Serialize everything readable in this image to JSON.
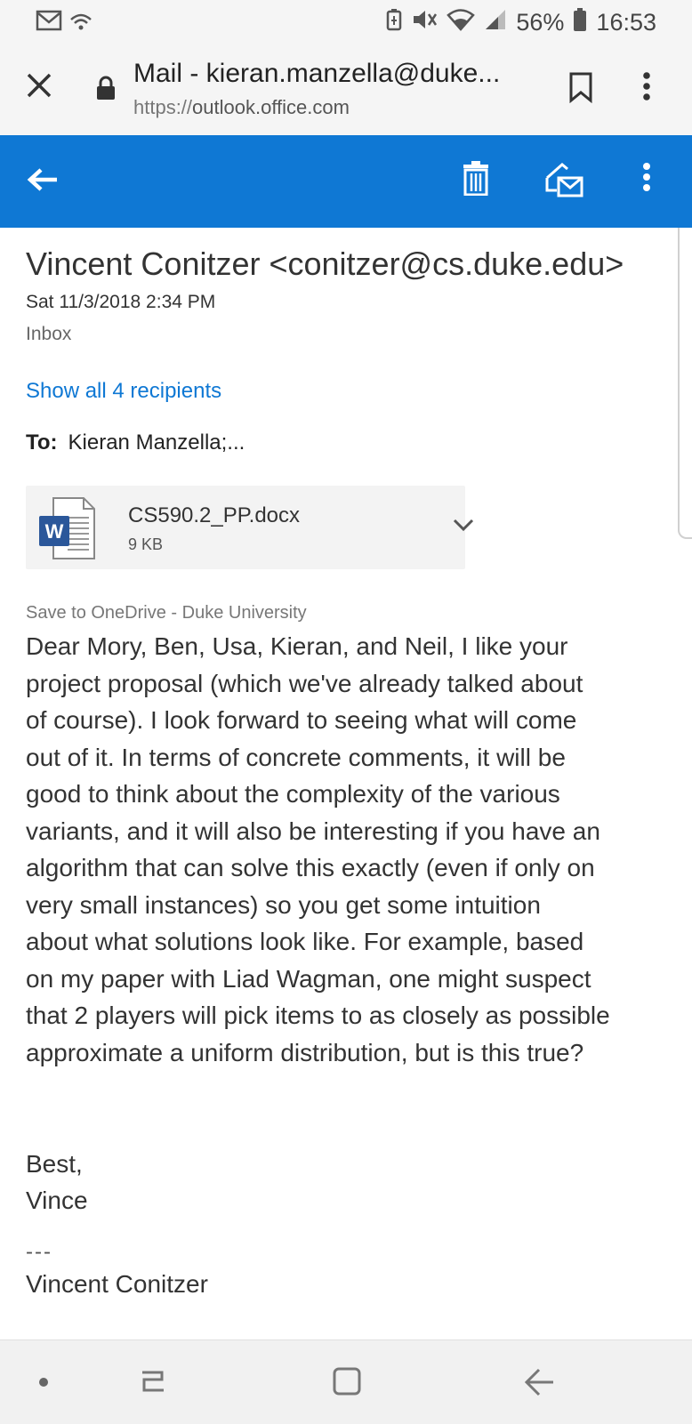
{
  "status_bar": {
    "battery": "56%",
    "time": "16:53"
  },
  "browser": {
    "title": "Mail - kieran.manzella@duke...",
    "url_prefix": "https://",
    "url_host": "outlook.office.com"
  },
  "email": {
    "sender": "Vincent Conitzer <conitzer@cs.duke.edu>",
    "date": "Sat 11/3/2018 2:34 PM",
    "folder": "Inbox",
    "recipients_link": "Show all 4 recipients",
    "to_label": "To:",
    "to_value": "Kieran Manzella;...",
    "attachment": {
      "name": "CS590.2_PP.docx",
      "size": "9 KB"
    },
    "save_link": "Save to OneDrive - Duke University",
    "body_lines": [
      "Dear Mory, Ben, Usa, Kieran, and Neil, I like your",
      "project proposal (which we've already talked about",
      "of course).  I look forward to seeing what will come",
      "out of it.  In terms of concrete comments, it will be",
      "good to think about the complexity of the various",
      "variants, and it will also be interesting if you have an",
      "algorithm that can solve this exactly (even if only on",
      "very small instances) so you get some intuition",
      "about what solutions look like.  For example, based",
      "on my paper with Liad Wagman, one might suspect",
      "that 2 players will pick items to as closely as possible",
      "approximate a uniform distribution, but is this true?"
    ],
    "signoff_1": "Best,",
    "signoff_2": "Vince",
    "signature_separator": "---",
    "signature_name": "Vincent Conitzer"
  },
  "colors": {
    "accent": "#0f78d4",
    "word_blue": "#2b579a"
  }
}
